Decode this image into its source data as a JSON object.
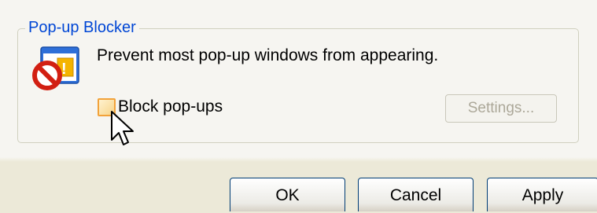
{
  "popup_blocker": {
    "group_title": "Pop-up Blocker",
    "icon": "popup-blocker-icon",
    "description": "Prevent most pop-up windows from appearing.",
    "block_popups_label": "Block pop-ups",
    "block_popups_checked": false,
    "settings_label": "Settings...",
    "settings_enabled": false
  },
  "dialog_buttons": {
    "ok_label": "OK",
    "cancel_label": "Cancel",
    "apply_label": "Apply"
  },
  "colors": {
    "group_title": "#0046D5",
    "dialog_background": "#ECE9D8",
    "panel_background": "#F6F5F1",
    "checkbox_hover_border": "#F2A23A",
    "disabled_text": "#ACA899"
  }
}
